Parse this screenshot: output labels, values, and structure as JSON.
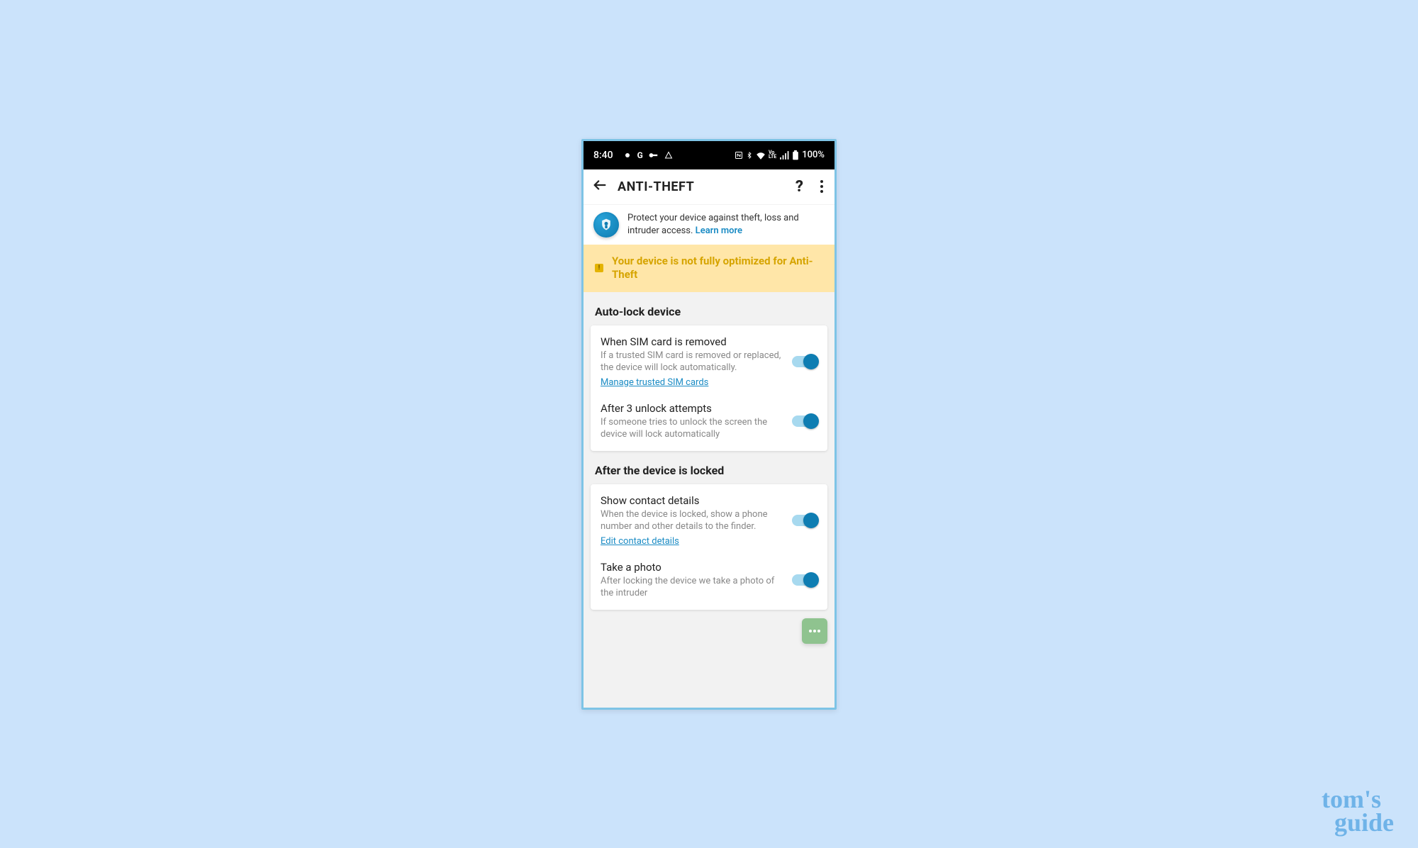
{
  "status": {
    "time": "8:40",
    "battery": "100%"
  },
  "actionbar": {
    "title": "ANTI-THEFT",
    "help": "?"
  },
  "intro": {
    "text": "Protect your device against theft, loss and intruder access. ",
    "link": "Learn more"
  },
  "banner": {
    "text": "Your device is not fully optimized for Anti-Theft"
  },
  "section1": {
    "header": "Auto-lock device",
    "item1": {
      "title": "When SIM card is removed",
      "desc": "If a trusted SIM card is removed or replaced, the device will lock automatically.",
      "link": "Manage trusted SIM cards"
    },
    "item2": {
      "title": "After 3 unlock attempts",
      "desc": "If someone tries to unlock the screen the device will lock automatically"
    }
  },
  "section2": {
    "header": "After the device is locked",
    "item1": {
      "title": "Show contact details",
      "desc": "When the device is locked, show a phone number and other details to the finder.",
      "link": "Edit contact details"
    },
    "item2": {
      "title": "Take a photo",
      "desc": "After locking the device we take a photo of the intruder"
    }
  },
  "watermark": {
    "line1": "tom's",
    "line2": "guide"
  }
}
